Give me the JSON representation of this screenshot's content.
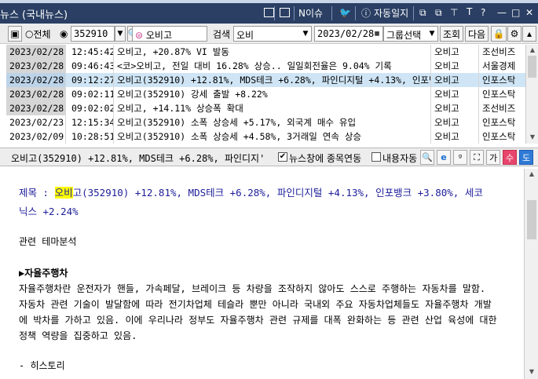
{
  "window": {
    "title": "뉴스 (국내뉴스)",
    "n_issue": "N이슈",
    "auto_journal": "자동일지",
    "font_btn": "T"
  },
  "toolbar": {
    "radio_all": "전체",
    "code": "352910",
    "stock_name": "오비고",
    "search_label": "검색",
    "search_value": "오비",
    "date": "2023/02/28",
    "group_select": "그룹선택",
    "query_button": "조회",
    "next_button": "다음"
  },
  "news_list": [
    {
      "date": "2023/02/28",
      "time": "12:45:42",
      "title": "오비고, +20.87% VI 발동",
      "stock": "오비고",
      "source": "조선비즈"
    },
    {
      "date": "2023/02/28",
      "time": "09:46:43",
      "title": "<코>오비고, 전일 대비 16.28% 상승.. 일일회전율은 9.04% 기록",
      "stock": "오비고",
      "source": "서울경제"
    },
    {
      "date": "2023/02/28",
      "time": "09:12:27",
      "title": "오비고(352910) +12.81%, MDS테크 +6.28%, 파인디지털 +4.13%, 인포뱅",
      "stock": "오비고",
      "source": "인포스탁"
    },
    {
      "date": "2023/02/28",
      "time": "09:02:11",
      "title": "오비고(352910) 강세 출발 +8.22%",
      "stock": "오비고",
      "source": "인포스탁"
    },
    {
      "date": "2023/02/28",
      "time": "09:02:02",
      "title": "오비고, +14.11% 상승폭 확대",
      "stock": "오비고",
      "source": "조선비즈"
    },
    {
      "date": "2023/02/23",
      "time": "12:15:34",
      "title": "오비고(352910) 소폭 상승세 +5.17%, 외국계 매수 유입",
      "stock": "오비고",
      "source": "인포스탁"
    },
    {
      "date": "2023/02/09",
      "time": "10:28:51",
      "title": "오비고(352910) 소폭 상승세 +4.58%, 3거래일 연속 상승",
      "stock": "오비고",
      "source": "인포스탁"
    }
  ],
  "detail": {
    "headline": "오비고(352910)  +12.81%, MDS테크 +6.28%, 파인디지'",
    "news_link_label": "뉴스창에 종목연동",
    "content_auto_label": "내용자동",
    "sell_button": "수",
    "buy_button": "도",
    "ie_icon_text": "e",
    "ga_icon_text": "가"
  },
  "article": {
    "title_prefix": "제목 : ",
    "title_hl": "오비",
    "title_rest1": "고(352910) +12.81%, MDS테크 +6.28%, 파인디지털 +4.13%, 인포뱅크 +3.80%, 세코",
    "title_rest2": "닉스 +2.24%",
    "theme_label": "관련 테마분석",
    "section": "▶자율주행차",
    "p1": "자율주행차란 운전자가 핸들, 가속페달, 브레이크 등 차량을 조작하지 않아도 스스로 주행하는 자동차를 말함.",
    "p2": "자동차 관련 기술이 발달함에 따라 전기차업체 테슬라 뿐만 아니라 국내외 주요 자동차업체들도 자율주행차 개발",
    "p3": "에 박차를 가하고 있음. 이에 우리나라 정부도 자율주행차 관련 규제를 대폭 완화하는 등 관련 산업 육성에 대한",
    "p4": "정책 역량을 집중하고 있음.",
    "history": "- 히스토리"
  },
  "colors": {
    "titlebar": "#2a3f63",
    "selected_row": "#cfe5f5",
    "article_title": "#1d1d9a",
    "highlight": "#ffff00",
    "sell": "#e8456c",
    "buy": "#2f7ad6"
  }
}
